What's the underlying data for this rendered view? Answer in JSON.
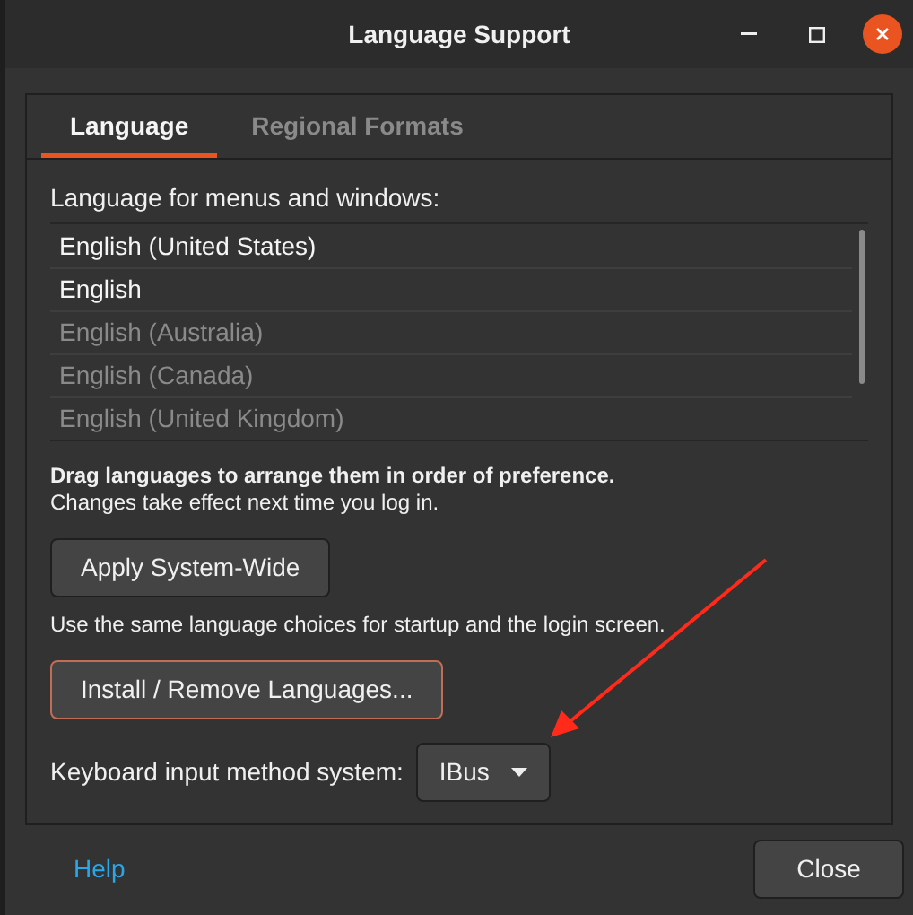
{
  "window": {
    "title": "Language Support"
  },
  "tabs": [
    {
      "label": "Language",
      "selected": true
    },
    {
      "label": "Regional Formats",
      "selected": false
    }
  ],
  "language_list": {
    "label": "Language for menus and windows:",
    "items": [
      {
        "label": "English (United States)",
        "disabled": false
      },
      {
        "label": "English",
        "disabled": false
      },
      {
        "label": "English (Australia)",
        "disabled": true
      },
      {
        "label": "English (Canada)",
        "disabled": true
      },
      {
        "label": "English (United Kingdom)",
        "disabled": true
      }
    ]
  },
  "hint": {
    "title": "Drag languages to arrange them in order of preference.",
    "text": "Changes take effect next time you log in."
  },
  "apply_button": "Apply System-Wide",
  "apply_note": "Use the same language choices for startup and the login screen.",
  "install_button": "Install / Remove Languages...",
  "input_method": {
    "label": "Keyboard input method system:",
    "value": "IBus"
  },
  "help_link": "Help",
  "close_button": "Close"
}
